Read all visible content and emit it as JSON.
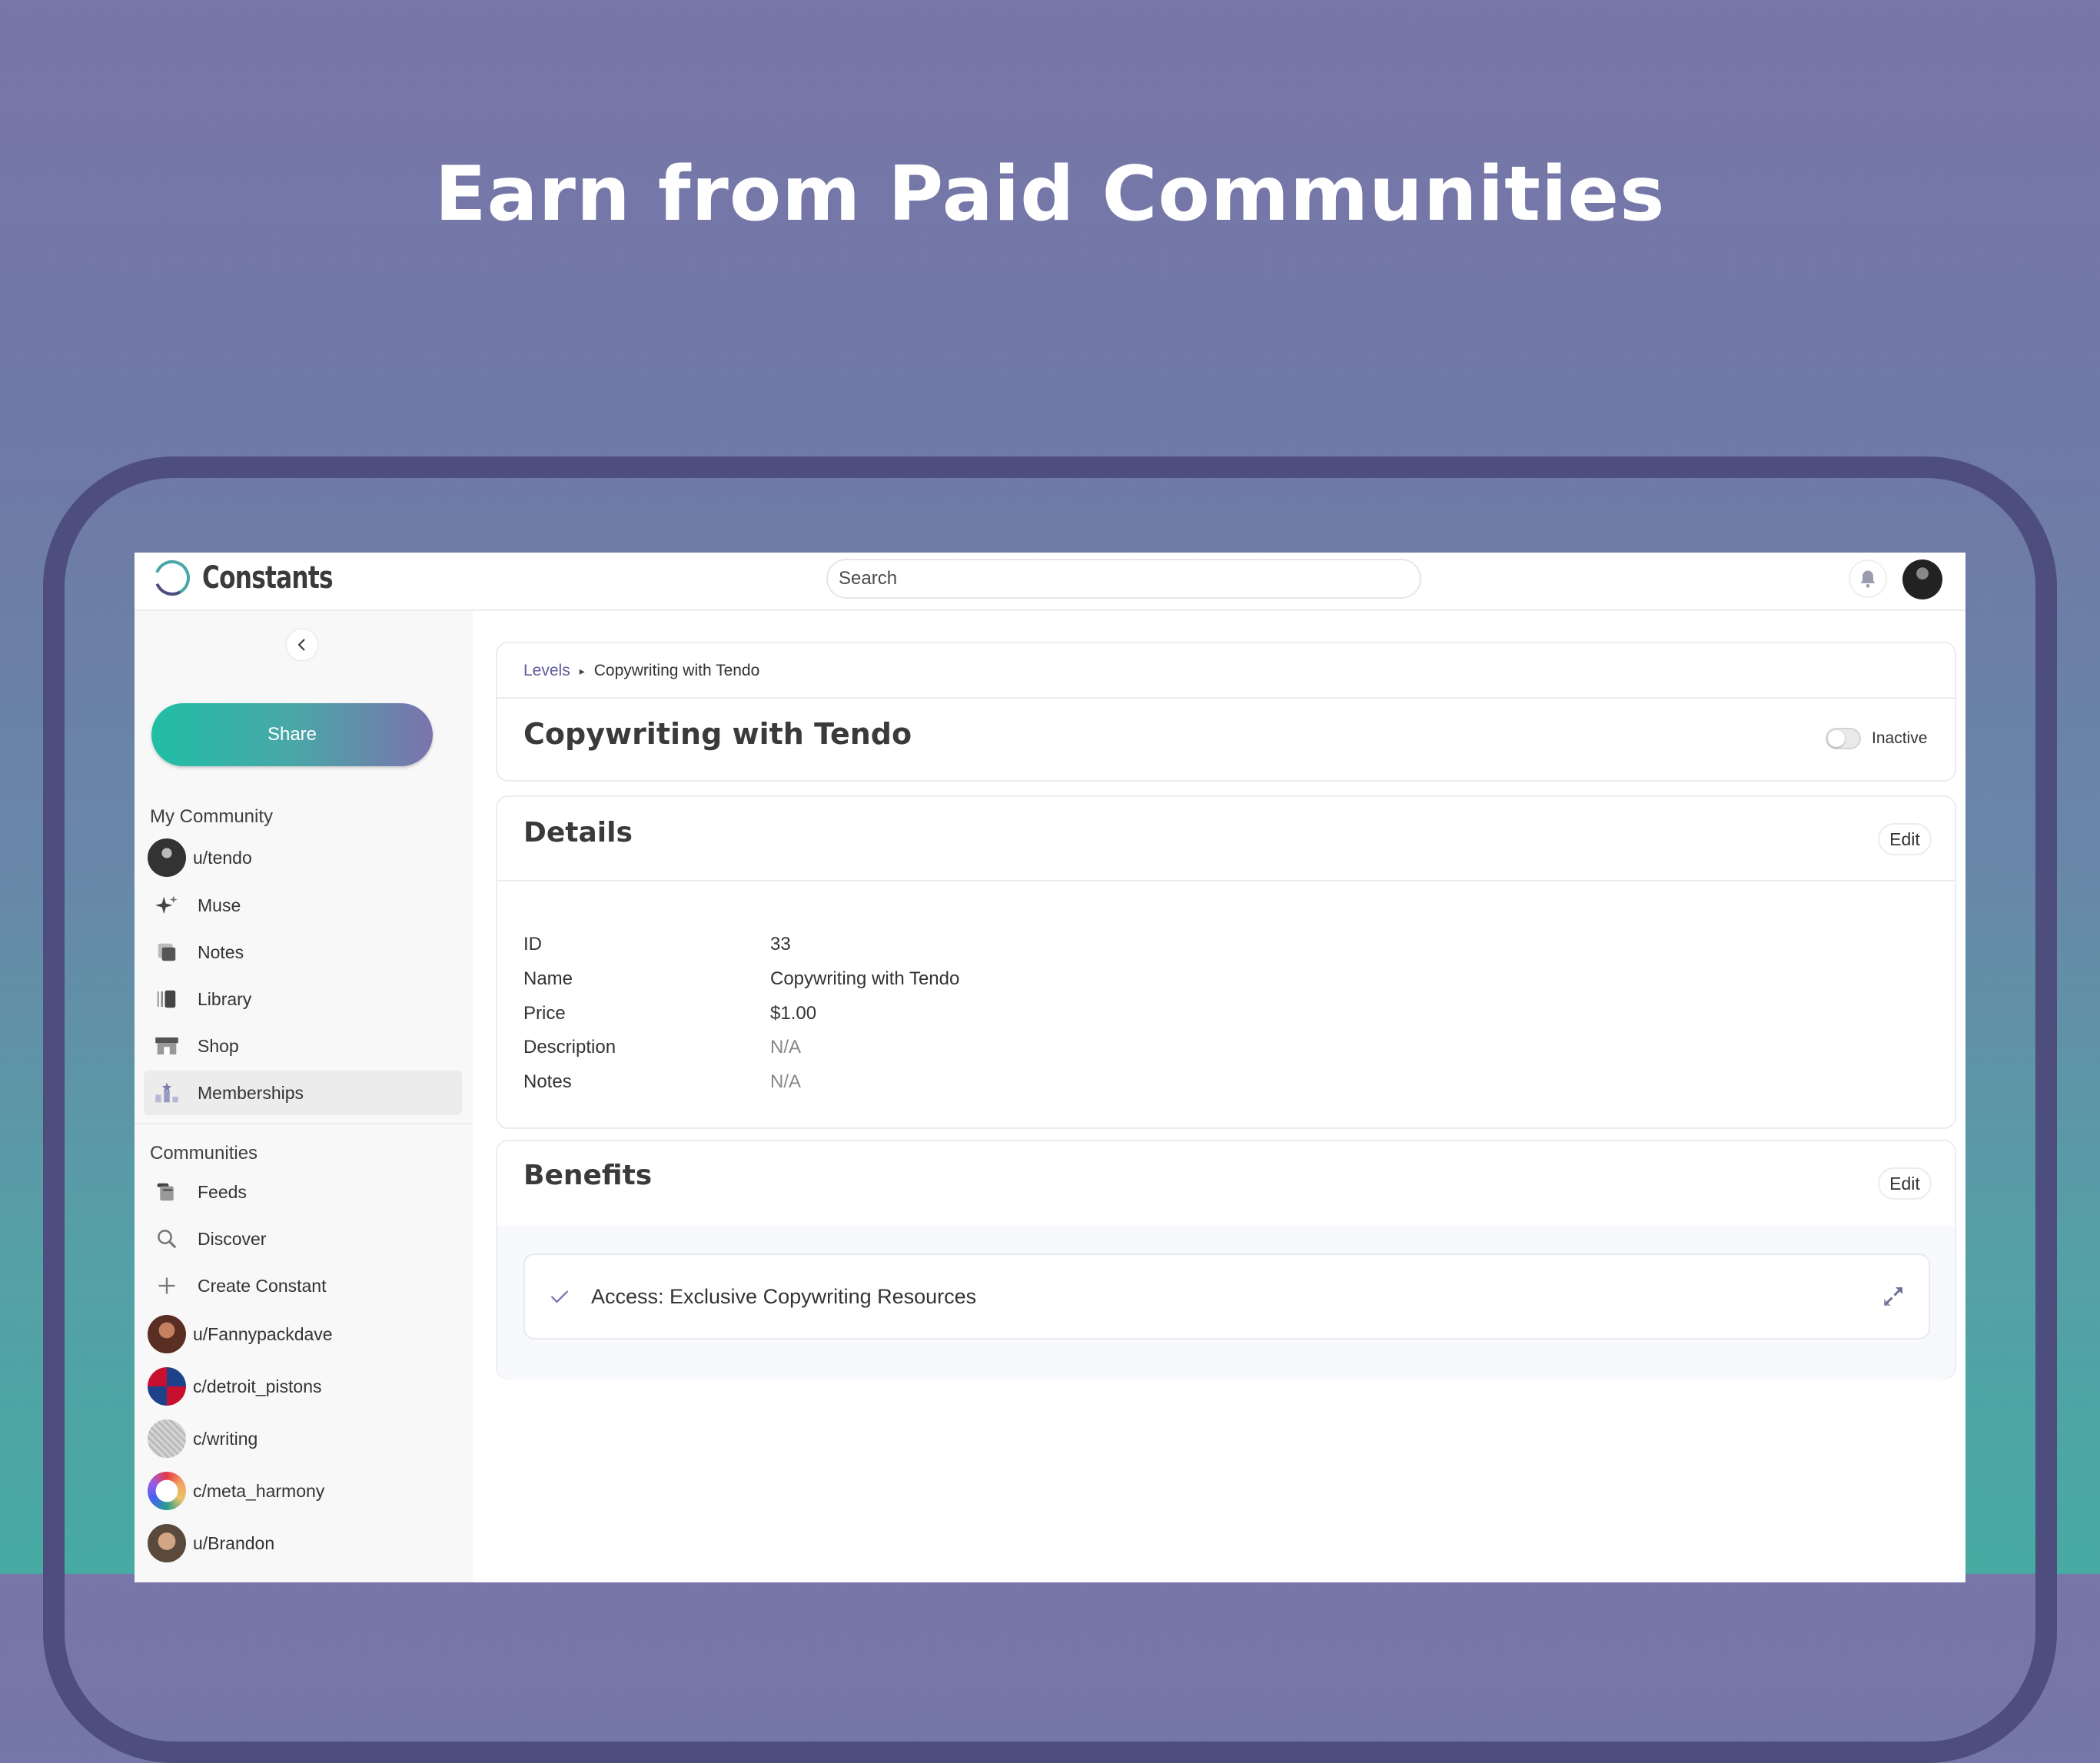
{
  "headline": "Earn from Paid Communities",
  "app": {
    "name": "Constants"
  },
  "search": {
    "placeholder": "Search"
  },
  "sidebar": {
    "share_label": "Share",
    "my_community_label": "My Community",
    "my_community": [
      {
        "label": "u/tendo",
        "icon": "avatar"
      },
      {
        "label": "Muse",
        "icon": "sparkles-icon"
      },
      {
        "label": "Notes",
        "icon": "notes-icon"
      },
      {
        "label": "Library",
        "icon": "library-icon"
      },
      {
        "label": "Shop",
        "icon": "shop-icon"
      },
      {
        "label": "Memberships",
        "icon": "memberships-icon",
        "active": true
      }
    ],
    "communities_label": "Communities",
    "communities": [
      {
        "label": "Feeds",
        "icon": "feeds-icon"
      },
      {
        "label": "Discover",
        "icon": "search-icon"
      },
      {
        "label": "Create Constant",
        "icon": "plus-icon"
      },
      {
        "label": "u/Fannypackdave",
        "icon": "avatar"
      },
      {
        "label": "c/detroit_pistons",
        "icon": "avatar"
      },
      {
        "label": "c/writing",
        "icon": "avatar"
      },
      {
        "label": "c/meta_harmony",
        "icon": "avatar"
      },
      {
        "label": "u/Brandon",
        "icon": "avatar"
      }
    ]
  },
  "level": {
    "breadcrumb_root": "Levels",
    "breadcrumb_current": "Copywriting with Tendo",
    "title": "Copywriting with Tendo",
    "status": "Inactive",
    "active": false
  },
  "details": {
    "title": "Details",
    "edit_label": "Edit",
    "rows": [
      {
        "key": "ID",
        "value": "33"
      },
      {
        "key": "Name",
        "value": "Copywriting with Tendo"
      },
      {
        "key": "Price",
        "value": "$1.00"
      },
      {
        "key": "Description",
        "value": "N/A"
      },
      {
        "key": "Notes",
        "value": "N/A"
      }
    ]
  },
  "benefits": {
    "title": "Benefits",
    "edit_label": "Edit",
    "items": [
      {
        "label": "Access: Exclusive Copywriting Resources"
      }
    ]
  },
  "colors": {
    "accent": "#5e5b98",
    "share_gradient_start": "#1fbfa6",
    "share_gradient_end": "#7b73ad",
    "frame": "#4d4e7d"
  }
}
